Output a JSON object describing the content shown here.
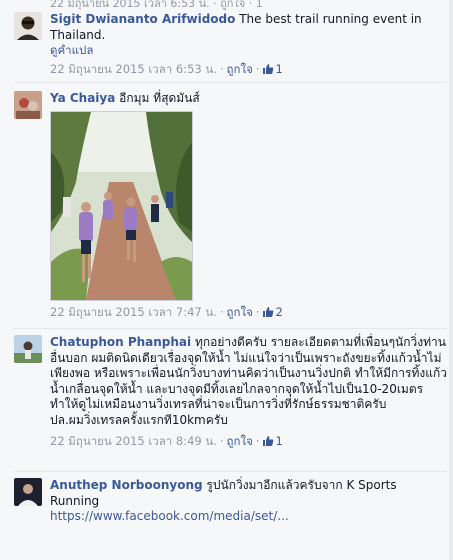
{
  "top_partial": "22 มิถุนายน 2015 เวลา 6:53 น. · ถูกใจ · 1",
  "comments": [
    {
      "author": "Sigit Dwiananto Arifwidodo",
      "text": "The best trail running event in Thailand.",
      "translate": "ดูคำแปล",
      "time": "22 มิถุนายน 2015 เวลา 6:53 น.",
      "like": "ถูกใจ",
      "likes": "1"
    },
    {
      "author": "Ya Chaiya",
      "text": "อีกมุม ที่สุดมันส์",
      "time": "22 มิถุนายน 2015 เวลา 7:47 น.",
      "like": "ถูกใจ",
      "likes": "2"
    },
    {
      "author": "Chatuphon Phanphai",
      "text": "ทุกอย่างดีครับ รายละเอียดตามที่เพื่อนๆนักวิ่งท่านอื่นบอก ผมติดนิดเดียวเรื่องจุดให้น้ำ ไม่แน่ใจว่าเป็นเพราะถังขยะทิ้งแก้วน้ำไม่เพียงพอ หรือเพราะเพื่อนนักวิ่งบางท่านคิดว่าเป็นงานวิ่งปกติ ทำให้มีการทิ้งแก้วน้ำเกลื่อนจุดให้น้ำ และบางจุดมีทิ้งเลยไกลจากจุดให้น้ำไปเป็น10-20เมตร ทำให้ดูไม่เหมือนงานวิ่งเทรลที่น่าจะเป็นการวิ่งที่รักษ์ธรรมชาติครับ",
      "text2": "ปล.ผมวิ่งเทรลครั้งแรกที10kmครับ",
      "time": "22 มิถุนายน 2015 เวลา 8:49 น.",
      "like": "ถูกใจ",
      "likes": "1"
    },
    {
      "author": "Anuthep Norboonyong",
      "text": "รูปนักวิ่งมาอีกแล้วครับจาก K Sports Running",
      "url": "https://www.facebook.com/media/set/..."
    }
  ],
  "colors": {
    "link": "#3b5998",
    "meta": "#9197a3",
    "text": "#141823",
    "bg": "#f6f7f9"
  },
  "icons": {
    "like": "thumbs-up-icon"
  }
}
